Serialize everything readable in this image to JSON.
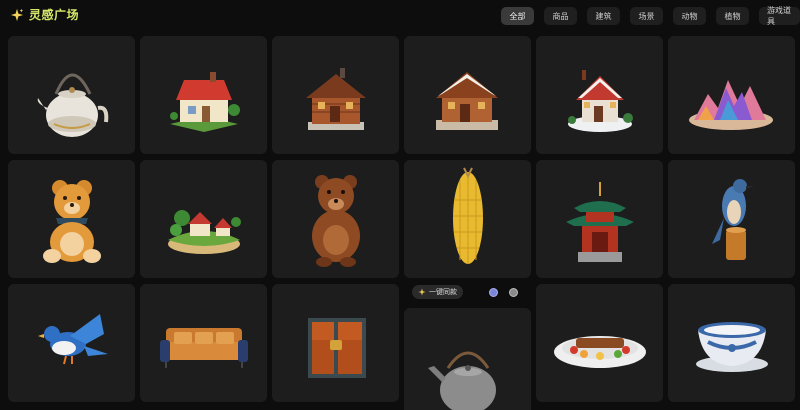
{
  "app": {
    "title": "灵感广场"
  },
  "tabs": [
    {
      "label": "全部",
      "active": true
    },
    {
      "label": "商品",
      "active": false
    },
    {
      "label": "建筑",
      "active": false
    },
    {
      "label": "场景",
      "active": false
    },
    {
      "label": "动物",
      "active": false
    },
    {
      "label": "植物",
      "active": false
    },
    {
      "label": "游戏道具",
      "active": false
    }
  ],
  "cards": [
    {
      "name": "teapot"
    },
    {
      "name": "red-roof-cottage"
    },
    {
      "name": "log-cabin"
    },
    {
      "name": "snowy-log-cabin"
    },
    {
      "name": "snow-chalet"
    },
    {
      "name": "crystal-island"
    },
    {
      "name": "teddy-bear"
    },
    {
      "name": "village-island"
    },
    {
      "name": "brown-bear"
    },
    {
      "name": "corn"
    },
    {
      "name": "chinese-pavilion"
    },
    {
      "name": "blue-bird-on-stump"
    },
    {
      "name": "blue-bird"
    },
    {
      "name": "sofa"
    },
    {
      "name": "treasure-chest"
    },
    {
      "name": "kettle"
    },
    {
      "name": "food-platter"
    },
    {
      "name": "porcelain-bowl"
    }
  ],
  "hover_actions": {
    "generate_label": "一键同款",
    "generate_icon": "sparkle-icon"
  },
  "colors": {
    "accent": "#d6e86a",
    "card_bg": "#1d1d1d",
    "page_bg": "#0d0d0d"
  }
}
